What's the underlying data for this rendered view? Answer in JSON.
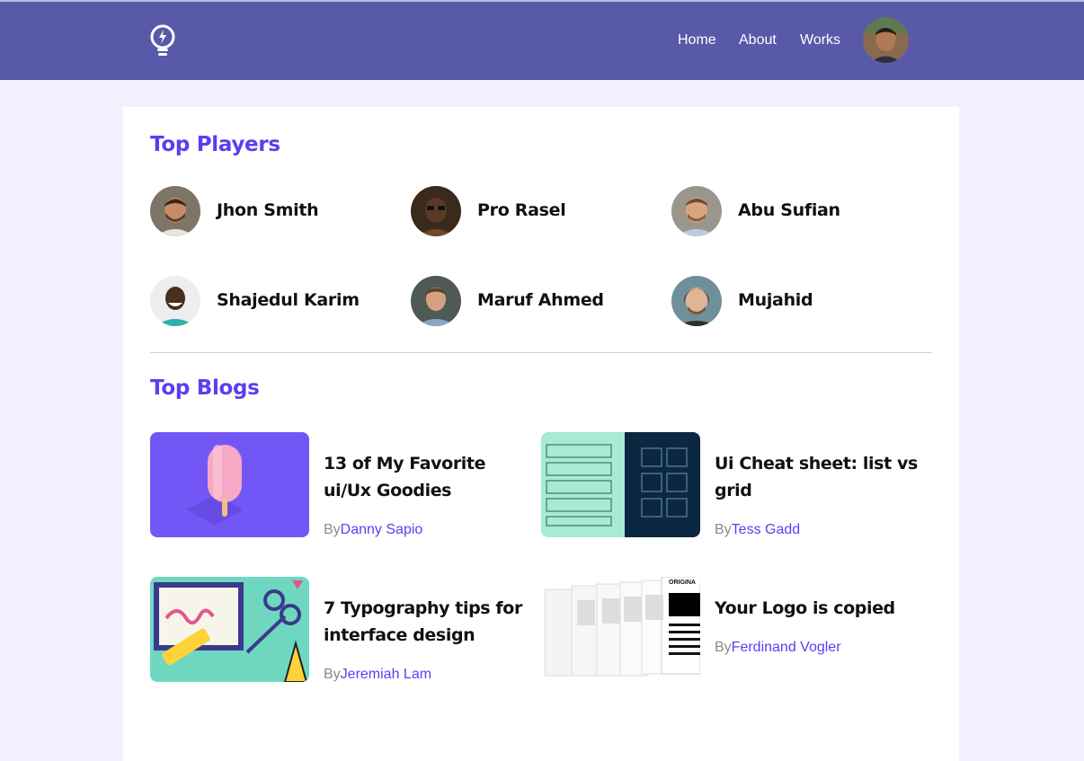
{
  "header": {
    "nav": [
      "Home",
      "About",
      "Works"
    ],
    "logo_icon": "bulb-logo-icon",
    "background": "#5859a9"
  },
  "players_section": {
    "title": "Top Players",
    "players": [
      {
        "name": "Jhon Smith"
      },
      {
        "name": "Pro Rasel"
      },
      {
        "name": "Abu Sufian"
      },
      {
        "name": "Shajedul Karim"
      },
      {
        "name": "Maruf Ahmed"
      },
      {
        "name": "Mujahid"
      }
    ]
  },
  "blogs_section": {
    "title": "Top Blogs",
    "by_prefix": "By",
    "blogs": [
      {
        "title": "13 of My Favorite ui/Ux Goodies",
        "author": "Danny Sapio"
      },
      {
        "title": "Ui Cheat sheet: list vs grid",
        "author": "Tess Gadd"
      },
      {
        "title": "7 Typography tips for interface design",
        "author": "Jeremiah Lam"
      },
      {
        "title": "Your Logo is copied",
        "author": "Ferdinand Vogler"
      }
    ],
    "thumb_text": {
      "original": "ORIGINA"
    }
  },
  "colors": {
    "accent": "#5f3cf0",
    "page_bg": "#f2f0ff"
  }
}
